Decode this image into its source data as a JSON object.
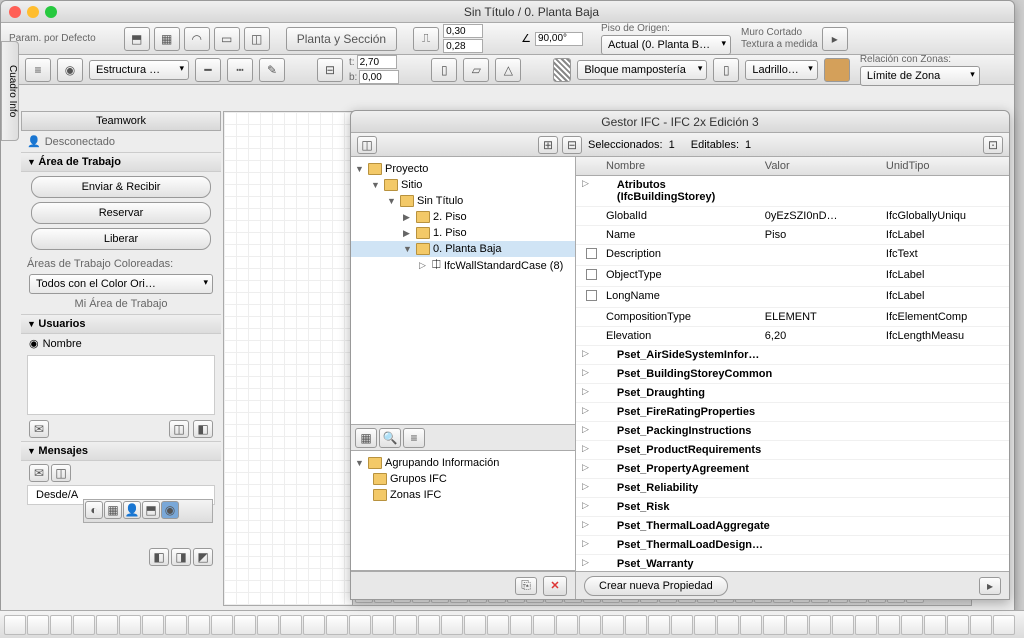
{
  "window": {
    "title": "Sin Título / 0. Planta Baja"
  },
  "vtab": "Cuadro Info",
  "toolbar1": {
    "param": "Param. por Defecto",
    "section_btn": "Planta y Sección",
    "h1": "0,30",
    "h2": "0,28",
    "angle": "90,00°",
    "origin_lbl": "Piso de Origen:",
    "origin_val": "Actual (0. Planta B…",
    "muro": "Muro Cortado",
    "textura": "Textura a medida"
  },
  "toolbar2": {
    "structure": "Estructura …",
    "t": "2,70",
    "b": "0,00",
    "bloque": "Bloque mampostería",
    "ladrillo": "Ladrillo…",
    "zona_lbl": "Relación con Zonas:",
    "zona_val": "Límite de Zona"
  },
  "sidebar": {
    "title": "Teamwork",
    "disconnected": "Desconectado",
    "area_head": "Área de Trabajo",
    "btn_send": "Enviar & Recibir",
    "btn_reserve": "Reservar",
    "btn_release": "Liberar",
    "colored_lbl": "Áreas de Trabajo Coloreadas:",
    "colored_val": "Todos con el Color Ori…",
    "my_area": "Mi Área de Trabajo",
    "users_head": "Usuarios",
    "user_col": "Nombre",
    "messages_head": "Mensajes",
    "desde": "Desde/A"
  },
  "ifc": {
    "title": "Gestor IFC - IFC 2x Edición 3",
    "sel_lbl": "Seleccionados:",
    "sel_n": "1",
    "edit_lbl": "Editables:",
    "edit_n": "1",
    "tree": [
      {
        "d": 0,
        "open": true,
        "lbl": "Proyecto",
        "icon": "proj"
      },
      {
        "d": 1,
        "open": true,
        "lbl": "Sitio"
      },
      {
        "d": 2,
        "open": true,
        "lbl": "Sin Título"
      },
      {
        "d": 3,
        "open": false,
        "lbl": "2. Piso"
      },
      {
        "d": 3,
        "open": false,
        "lbl": "1. Piso"
      },
      {
        "d": 3,
        "open": true,
        "lbl": "0. Planta Baja",
        "sel": true
      },
      {
        "d": 4,
        "leaf": true,
        "lbl": "IfcWallStandardCase (8)"
      }
    ],
    "group_head": "Agrupando Información",
    "group1": "Grupos IFC",
    "group2": "Zonas IFC",
    "cols": {
      "c1": "Nombre",
      "c2": "Valor",
      "c3": "UnidTipo"
    },
    "props": [
      {
        "bold": true,
        "exp": true,
        "n": "Atributos (IfcBuildingStorey)"
      },
      {
        "n": "GlobalId",
        "v": "0yEzSZI0nD…",
        "t": "IfcGloballyUniqu"
      },
      {
        "n": "Name",
        "v": "Piso",
        "t": "IfcLabel"
      },
      {
        "chk": true,
        "n": "Description",
        "t": "IfcText"
      },
      {
        "chk": true,
        "n": "ObjectType",
        "t": "IfcLabel"
      },
      {
        "chk": true,
        "n": "LongName",
        "t": "IfcLabel"
      },
      {
        "n": "CompositionType",
        "v": "ELEMENT",
        "t": "IfcElementComp"
      },
      {
        "n": "Elevation",
        "v": "6,20",
        "t": "IfcLengthMeasu"
      },
      {
        "bold": true,
        "exp": true,
        "n": "Pset_AirSideSystemInfor…"
      },
      {
        "bold": true,
        "exp": true,
        "n": "Pset_BuildingStoreyCommon"
      },
      {
        "bold": true,
        "exp": true,
        "n": "Pset_Draughting"
      },
      {
        "bold": true,
        "exp": true,
        "n": "Pset_FireRatingProperties"
      },
      {
        "bold": true,
        "exp": true,
        "n": "Pset_PackingInstructions"
      },
      {
        "bold": true,
        "exp": true,
        "n": "Pset_ProductRequirements"
      },
      {
        "bold": true,
        "exp": true,
        "n": "Pset_PropertyAgreement"
      },
      {
        "bold": true,
        "exp": true,
        "n": "Pset_Reliability"
      },
      {
        "bold": true,
        "exp": true,
        "n": "Pset_Risk"
      },
      {
        "bold": true,
        "exp": true,
        "n": "Pset_ThermalLoadAggregate"
      },
      {
        "bold": true,
        "exp": true,
        "n": "Pset_ThermalLoadDesign…"
      },
      {
        "bold": true,
        "exp": true,
        "n": "Pset_Warranty"
      }
    ],
    "new_prop": "Crear nueva Propiedad"
  }
}
